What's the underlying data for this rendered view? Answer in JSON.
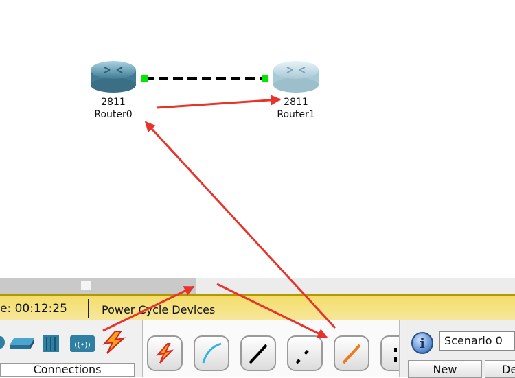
{
  "workspace": {
    "routers": [
      {
        "model": "2811",
        "name": "Router0"
      },
      {
        "model": "2811",
        "name": "Router1"
      }
    ],
    "link_status_color": "#00e600",
    "link_style": "dashed crossover"
  },
  "statusbar": {
    "time_text": "e: 00:12:25",
    "power_cycle_label": "Power Cycle Devices"
  },
  "device_panel": {
    "icons": [
      "router-icon",
      "switch-icon",
      "hub-icon",
      "wireless-device-icon",
      "connections-icon"
    ],
    "category_label": "Connections"
  },
  "cable_panel": {
    "cables": [
      "automatic-connection-icon",
      "console-cable-icon",
      "copper-straight-through-icon",
      "copper-cross-over-icon",
      "fiber-cable-icon",
      "phone-cable-icon"
    ]
  },
  "scenario_panel": {
    "selected": "Scenario 0",
    "new_label": "New",
    "delete_label": "De"
  },
  "colors": {
    "annotation_arrow": "#e8332a",
    "timebar": "#f3de6b",
    "router_body": "#6fa6bd"
  }
}
